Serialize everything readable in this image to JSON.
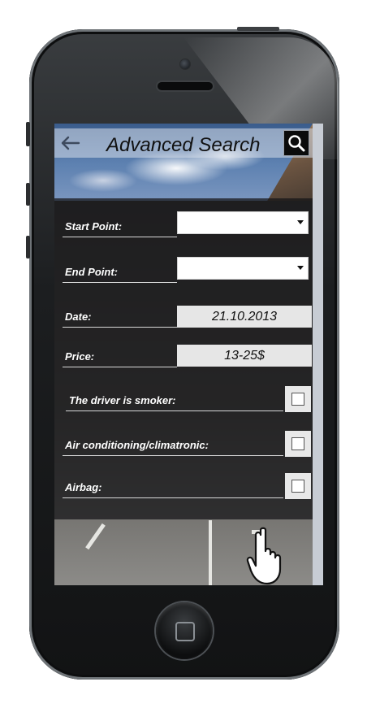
{
  "app": {
    "title": "Advanced Search"
  },
  "header": {
    "back_icon": "back-arrow-icon",
    "search_icon": "search-icon"
  },
  "form": {
    "start_point": {
      "label": "Start Point:",
      "value": ""
    },
    "end_point": {
      "label": "End Point:",
      "value": ""
    },
    "date": {
      "label": "Date:",
      "value": "21.10.2013"
    },
    "price": {
      "label": "Price:",
      "value": "13-25$"
    },
    "smoker": {
      "label": "The driver is smoker:",
      "checked": false
    },
    "air_conditioning": {
      "label": "Air conditioning/climatronic:",
      "checked": false
    },
    "airbag": {
      "label": "Airbag:",
      "checked": false
    }
  },
  "colors": {
    "panel": "#141416",
    "text": "#ffffff",
    "title_bar": "#d7deea",
    "field_bg": "#e6e6e6"
  }
}
